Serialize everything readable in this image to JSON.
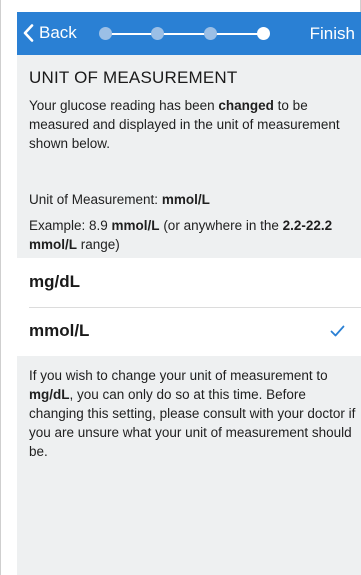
{
  "nav": {
    "back_label": "Back",
    "finish_label": "Finish",
    "steps": [
      {
        "state": "pending"
      },
      {
        "state": "pending"
      },
      {
        "state": "pending"
      },
      {
        "state": "current"
      }
    ],
    "color": "#2a80d4"
  },
  "section": {
    "title": "UNIT OF MEASUREMENT",
    "intro_pre": "Your glucose reading has been ",
    "intro_bold": "changed",
    "intro_post": " to be measured and displayed in the unit of measurement shown below."
  },
  "unit": {
    "label": "Unit of Measurement: ",
    "value": "mmol/L"
  },
  "example": {
    "pre": "Example: 8.9 ",
    "unit_bold": "mmol/L",
    "mid": " (or anywhere in the ",
    "range_bold": "2.2-22.2 mmol/L",
    "post": " range)"
  },
  "options": [
    {
      "label": "mg/dL",
      "selected": false
    },
    {
      "label": "mmol/L",
      "selected": true
    }
  ],
  "footnote": {
    "pre": "If you wish to change your unit of measurement to ",
    "bold": "mg/dL",
    "post": ", you can only do so at this time. Before changing this setting, please consult with your doctor if you are unsure what your unit of measurement should be."
  }
}
